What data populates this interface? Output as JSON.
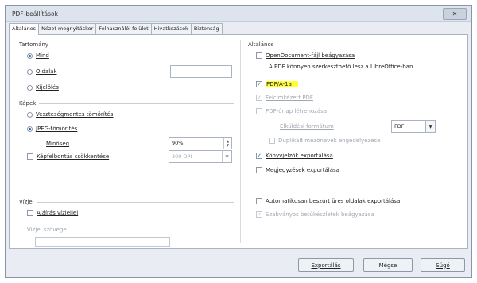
{
  "window": {
    "title": "PDF-beállítások",
    "close_glyph": "✕"
  },
  "tabs": [
    "Általános",
    "Nézet megnyitáskor",
    "Felhasználói felület",
    "Hivatkozások",
    "Biztonság"
  ],
  "left": {
    "range": {
      "heading": "Tartomány",
      "options": [
        {
          "label": "Mind",
          "selected": true
        },
        {
          "label": "Oldalak",
          "selected": false
        },
        {
          "label": "Kijelölés",
          "selected": false
        }
      ],
      "pages_value": ""
    },
    "images": {
      "heading": "Képek",
      "lossless_label": "Veszteségmentes tömörítés",
      "jpeg_label": "JPEG-tömörítés",
      "quality_label": "Minőség",
      "quality_value": "90%",
      "reduce_label": "Képfelbontás csökkentése",
      "reduce_value": "300 DPI"
    },
    "watermark": {
      "heading": "Vízjel",
      "sign_label": "Aláírás vízjellel",
      "text_label": "Vízjel szövege",
      "text_value": ""
    }
  },
  "right": {
    "heading": "Általános",
    "items": {
      "opendoc_label": "OpenDocument-fájl beágyazása",
      "opendoc_desc": "A PDF könnyen szerkeszthető lesz a LibreOffice-ban",
      "pdfa_label": "PDF/A-1a",
      "tagged_label": "Felcímkézett PDF",
      "form_label": "PDF-űrlap létrehozása",
      "submit_label": "Elküldési formátum",
      "submit_value": "FDF",
      "dup_label": "Duplikált mezőnevek engedélyezése",
      "bookmarks_label": "Könyvjelzők exportálása",
      "comments_label": "Megjegyzések exportálása",
      "blank_label": "Automatikusan beszúrt üres oldalak exportálása",
      "embed_label": "Szabványos betűkészletek beágyazása"
    }
  },
  "buttons": {
    "export": "Exportálás",
    "cancel": "Mégse",
    "help": "Súgó"
  },
  "glyphs": {
    "check": "✓",
    "dropdown": "▼",
    "up": "▲",
    "down": "▼"
  }
}
